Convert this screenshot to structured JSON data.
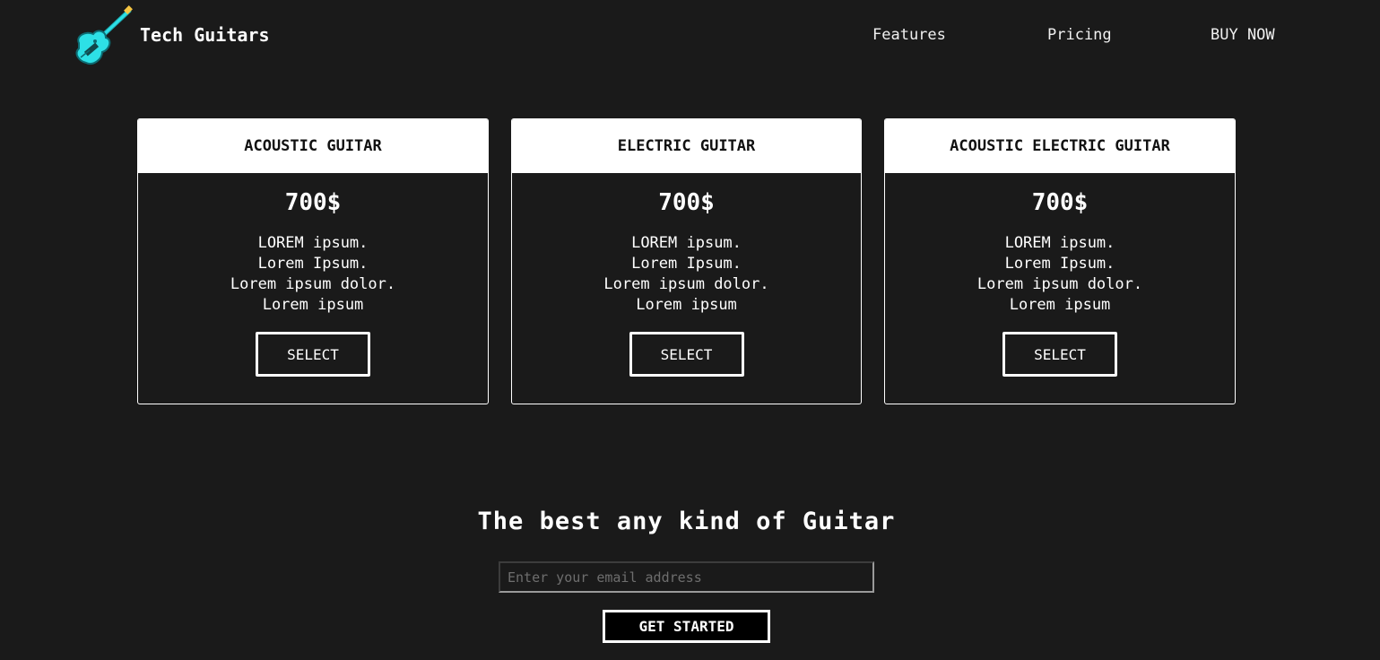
{
  "header": {
    "brand": "Tech Guitars",
    "logo_icon": "guitar-icon",
    "nav": [
      {
        "label": "Features"
      },
      {
        "label": "Pricing"
      },
      {
        "label": "BUY NOW"
      }
    ]
  },
  "cards": [
    {
      "title": "ACOUSTIC GUITAR",
      "price": "700$",
      "features": [
        "LOREM ipsum.",
        "Lorem Ipsum.",
        "Lorem ipsum dolor.",
        "Lorem ipsum"
      ],
      "button": "SELECT"
    },
    {
      "title": "ELECTRIC GUITAR",
      "price": "700$",
      "features": [
        "LOREM ipsum.",
        "Lorem Ipsum.",
        "Lorem ipsum dolor.",
        "Lorem ipsum"
      ],
      "button": "SELECT"
    },
    {
      "title": "ACOUSTIC ELECTRIC GUITAR",
      "price": "700$",
      "features": [
        "LOREM ipsum.",
        "Lorem Ipsum.",
        "Lorem ipsum dolor.",
        "Lorem ipsum"
      ],
      "button": "SELECT"
    }
  ],
  "cta": {
    "tagline": "The best any kind of Guitar",
    "email_placeholder": "Enter your email address",
    "email_value": "",
    "button": "GET STARTED"
  },
  "colors": {
    "background": "#1a1a1a",
    "text": "#ffffff",
    "logo_accent": "#2de0e6"
  }
}
